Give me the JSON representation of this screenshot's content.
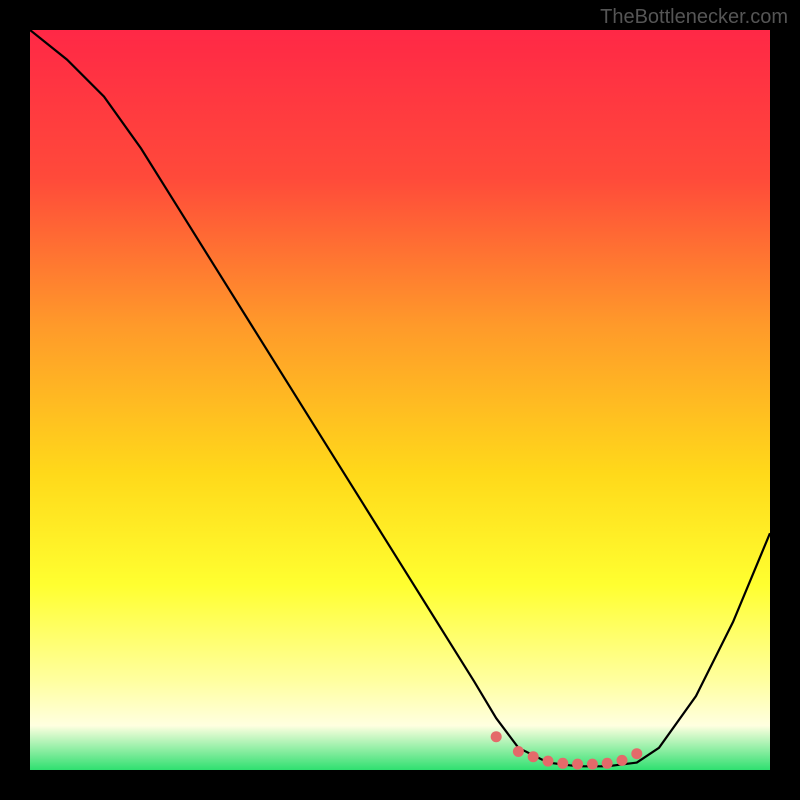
{
  "watermark": "TheBottlenecker.com",
  "chart_data": {
    "type": "line",
    "title": "",
    "xlabel": "",
    "ylabel": "",
    "xlim": [
      0,
      100
    ],
    "ylim": [
      0,
      100
    ],
    "background_gradient": {
      "stops": [
        {
          "offset": 0,
          "color": "#ff2846"
        },
        {
          "offset": 20,
          "color": "#ff4a3a"
        },
        {
          "offset": 40,
          "color": "#ff9a2a"
        },
        {
          "offset": 60,
          "color": "#ffd91a"
        },
        {
          "offset": 75,
          "color": "#ffff30"
        },
        {
          "offset": 88,
          "color": "#ffffa0"
        },
        {
          "offset": 94,
          "color": "#ffffe0"
        },
        {
          "offset": 100,
          "color": "#2fe070"
        }
      ]
    },
    "series": [
      {
        "name": "bottleneck-curve",
        "color": "#000000",
        "x": [
          0,
          5,
          10,
          15,
          20,
          25,
          30,
          35,
          40,
          45,
          50,
          55,
          60,
          63,
          66,
          70,
          74,
          78,
          82,
          85,
          90,
          95,
          100
        ],
        "values": [
          100,
          96,
          91,
          84,
          76,
          68,
          60,
          52,
          44,
          36,
          28,
          20,
          12,
          7,
          3,
          1,
          0.5,
          0.5,
          1,
          3,
          10,
          20,
          32
        ]
      }
    ],
    "markers": {
      "name": "highlight-dots",
      "color": "#e46a6a",
      "x": [
        63,
        66,
        68,
        70,
        72,
        74,
        76,
        78,
        80,
        82
      ],
      "values": [
        4.5,
        2.5,
        1.8,
        1.2,
        0.9,
        0.8,
        0.8,
        0.9,
        1.3,
        2.2
      ]
    }
  }
}
